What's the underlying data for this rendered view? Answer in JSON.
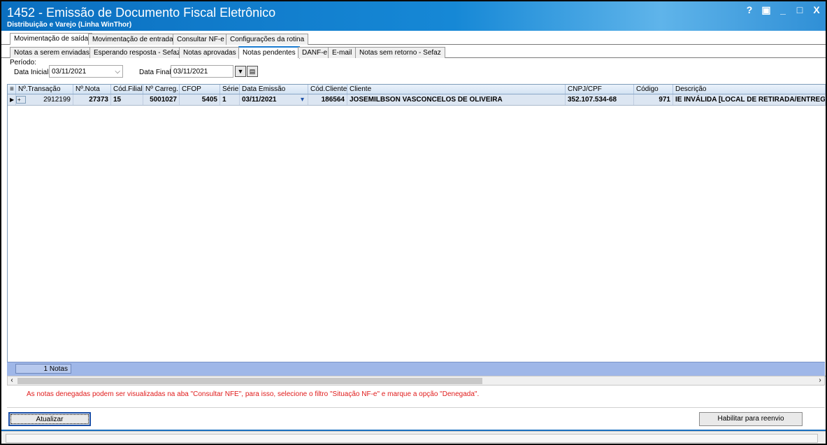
{
  "window": {
    "title": "1452 - Emissão de Documento Fiscal Eletrônico",
    "subtitle": "Distribuição e Varejo (Linha WinThor)",
    "controls": [
      "?",
      "▣",
      "_",
      "□",
      "X"
    ]
  },
  "tabs_main": [
    {
      "label": "Movimentação de saída",
      "active": true
    },
    {
      "label": "Movimentação de entrada",
      "active": false
    },
    {
      "label": "Consultar NF-e",
      "active": false
    },
    {
      "label": "Configurações da rotina",
      "active": false
    }
  ],
  "tabs_sub": [
    {
      "label": "Notas a serem enviadas",
      "active": false
    },
    {
      "label": "Esperando resposta - Sefaz",
      "active": false
    },
    {
      "label": "Notas aprovadas",
      "active": false
    },
    {
      "label": "Notas pendentes",
      "active": true
    },
    {
      "label": "DANF-e",
      "active": false
    },
    {
      "label": "E-mail",
      "active": false
    },
    {
      "label": "Notas sem retorno - Sefaz",
      "active": false
    }
  ],
  "filter": {
    "periodo_label": "Período:",
    "data_inicial_label": "Data Inicial",
    "data_inicial_value": "03/11/2021",
    "data_final_label": "Data Final",
    "data_final_value": "03/11/2021"
  },
  "grid": {
    "columns": [
      "Nº.Transação",
      "Nº.Nota",
      "Cód.Filial",
      "Nº Carreg.",
      "CFOP",
      "Série",
      "Data Emissão",
      "Cód.Cliente",
      "Cliente",
      "CNPJ/CPF",
      "Código",
      "Descrição"
    ],
    "rows": [
      {
        "transacao": "2912199",
        "nota": "27373",
        "filial": "15",
        "carreg": "5001027",
        "cfop": "5405",
        "serie": "1",
        "data_emissao": "03/11/2021",
        "cod_cliente": "186564",
        "cliente": "JOSEMILBSON VASCONCELOS DE OLIVEIRA",
        "cnpj_cpf": "352.107.534-68",
        "codigo": "971",
        "descricao": "IE INVÁLIDA [LOCAL DE RETIRADA/ENTREGA]"
      }
    ],
    "footer_count": "1 Notas"
  },
  "warning_text": "As notas denegadas podem ser visualizadas na aba \"Consultar NFE\", para isso, selecione o filtro \"Situação NF-e\" e marque a opção \"Denegada\".",
  "buttons": {
    "atualizar": "Atualizar",
    "habilitar": "Habilitar para reenvio"
  },
  "colors": {
    "title_blue": "#1688d6",
    "grid_row": "#dce6f2",
    "footer_bar": "#9fb7e8",
    "warning_red": "#e01b1b"
  }
}
